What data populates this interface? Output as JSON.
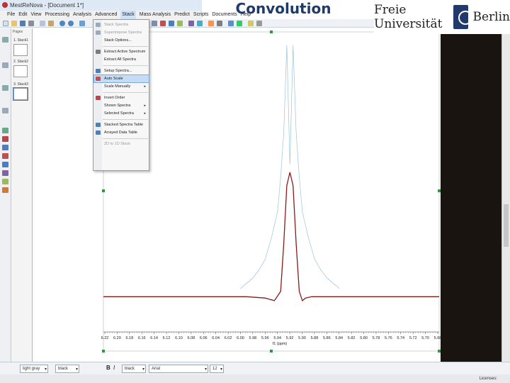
{
  "slide": {
    "title": "Convolution",
    "logo": {
      "left_word": "Freie Universität",
      "right_word": "Berlin"
    }
  },
  "window": {
    "title": "MestReNova - [Document 1*]"
  },
  "menubar": [
    "File",
    "Edit",
    "View",
    "Processing",
    "Analysis",
    "Advanced",
    "Stack",
    "Mass Analysis",
    "Predict",
    "Scripts",
    "Documents",
    "Help"
  ],
  "pages": {
    "header": "Pages",
    "items": [
      "1. Stack1",
      "2. Stack2",
      "3. Stack3"
    ]
  },
  "stack_menu": {
    "items": [
      {
        "label": "Stack Spectra",
        "enabled": false
      },
      {
        "label": "Superimpose Spectra",
        "enabled": false
      },
      {
        "label": "Stack Options...",
        "enabled": true
      },
      {
        "label": "Extract Active Spectrum",
        "enabled": true
      },
      {
        "label": "Extract All Spectra",
        "enabled": true
      },
      {
        "label": "Setup Spectra...",
        "enabled": true
      },
      {
        "label": "Auto Scale",
        "enabled": true,
        "highlighted": true
      },
      {
        "label": "Scale Manually",
        "enabled": true,
        "submenu": true
      },
      {
        "label": "Invert Order",
        "enabled": true
      },
      {
        "label": "Shown Spectra",
        "enabled": true,
        "submenu": true
      },
      {
        "label": "Selected Spectra",
        "enabled": true,
        "submenu": true
      },
      {
        "label": "Stacked Spectra Table",
        "enabled": true
      },
      {
        "label": "Arrayed Data Table",
        "enabled": true
      },
      {
        "label": "2D to 1D Stack",
        "enabled": false
      }
    ]
  },
  "chart_data": {
    "type": "line",
    "xlabel": "f1 (ppm)",
    "x_ticks": [
      "6.22",
      "6.20",
      "6.18",
      "6.16",
      "6.14",
      "6.12",
      "6.10",
      "6.08",
      "6.06",
      "6.04",
      "6.02",
      "6.00",
      "5.98",
      "5.96",
      "5.94",
      "5.92",
      "5.90",
      "5.88",
      "5.86",
      "5.84",
      "5.82",
      "5.80",
      "5.78",
      "5.76",
      "5.74",
      "5.72",
      "5.70",
      "5.68"
    ],
    "xlim": [
      6.22,
      5.68
    ],
    "x_reversed": true,
    "ylim": [
      -0.05,
      1.0
    ],
    "series": [
      {
        "color": "#9cc3dc",
        "x": [
          6.0,
          5.99,
          5.98,
          5.97,
          5.96,
          5.95,
          5.94,
          5.935,
          5.93,
          5.925,
          5.92,
          5.915,
          5.91,
          5.905,
          5.9,
          5.89,
          5.88,
          5.87,
          5.86,
          5.85,
          5.84
        ],
        "y": [
          0.03,
          0.05,
          0.07,
          0.1,
          0.14,
          0.22,
          0.32,
          0.45,
          0.62,
          0.95,
          0.5,
          0.95,
          0.62,
          0.45,
          0.32,
          0.22,
          0.14,
          0.1,
          0.07,
          0.05,
          0.03
        ]
      },
      {
        "color": "#8b1a1a",
        "x": [
          6.22,
          5.99,
          5.96,
          5.945,
          5.935,
          5.93,
          5.925,
          5.92,
          5.915,
          5.91,
          5.905,
          5.9,
          5.895,
          5.885,
          5.86,
          5.68
        ],
        "y": [
          0.0,
          0.0,
          -0.005,
          -0.015,
          0.02,
          0.2,
          0.42,
          0.47,
          0.42,
          0.2,
          0.02,
          -0.015,
          -0.005,
          0.0,
          0.0,
          0.0
        ]
      }
    ]
  },
  "bottom_toolbar": {
    "color_value": "light gray",
    "color2_value": "black",
    "color3_value": "black",
    "font_value": "Arial",
    "size_value": "12",
    "buttons": [
      "B",
      "I"
    ]
  },
  "statusbar": {
    "text": "Licenses:"
  }
}
